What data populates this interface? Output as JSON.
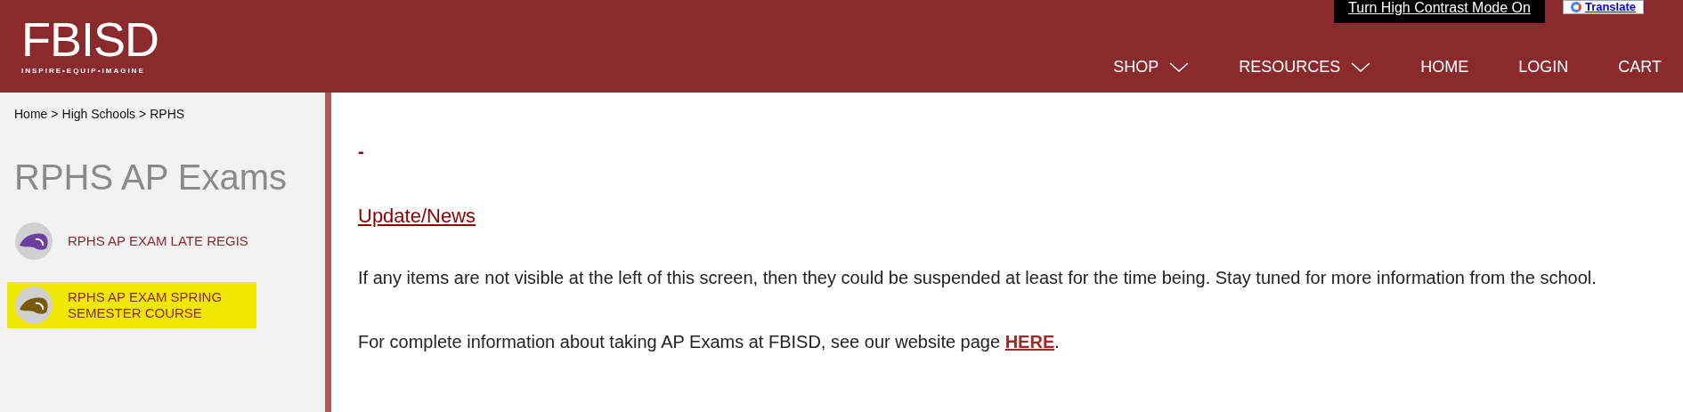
{
  "header": {
    "logo": {
      "name": "FBISD",
      "tagline": "INSPIRE•EQUIP•IMAGINE"
    },
    "contrast_button": "Turn High Contrast Mode On",
    "translate_button": "Translate",
    "nav": [
      {
        "label": "SHOP",
        "dropdown": true
      },
      {
        "label": "RESOURCES",
        "dropdown": true
      },
      {
        "label": "HOME",
        "dropdown": false
      },
      {
        "label": "LOGIN",
        "dropdown": false
      },
      {
        "label": "CART",
        "dropdown": false
      }
    ]
  },
  "sidebar": {
    "breadcrumb": [
      {
        "label": "Home"
      },
      {
        "label": "High Schools"
      },
      {
        "label": "RPHS"
      }
    ],
    "separator": ">",
    "title": "RPHS AP Exams",
    "items": [
      {
        "label": "RPHS AP EXAM LATE REGIS",
        "color": "#6b3fa0",
        "highlighted": false
      },
      {
        "label": "RPHS AP EXAM SPRING SEMESTER COURSE",
        "color": "#7a5a0a",
        "highlighted": true
      }
    ]
  },
  "content": {
    "dash": "-",
    "heading_link": "Update/News",
    "paragraphs": [
      {
        "text": "If any items are not visible at the left of this screen, then they could be suspended at least for the time being.  Stay tuned for more information from the school."
      },
      {
        "text": "For complete information about taking AP Exams at FBISD, see our website page ",
        "link": "HERE",
        "after": "."
      }
    ]
  }
}
